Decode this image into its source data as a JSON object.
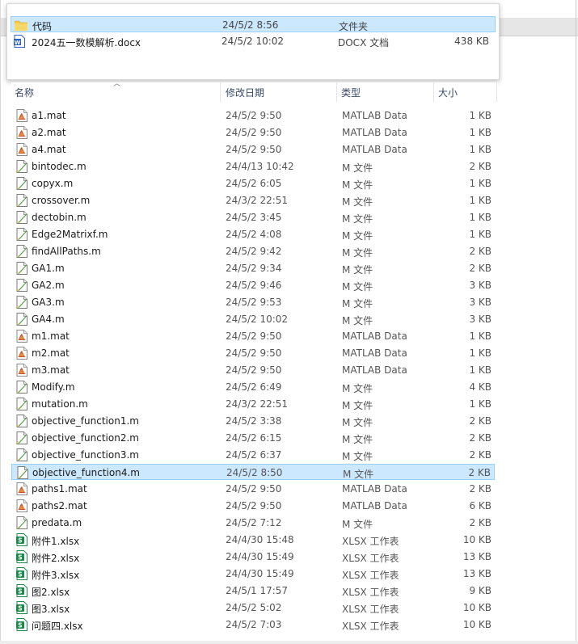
{
  "popup": {
    "rows": [
      {
        "icon": "folder-icon",
        "name": "代码",
        "date": "24/5/2 8:56",
        "type": "文件夹",
        "size": "",
        "selected": true
      },
      {
        "icon": "docx-icon",
        "name": "2024五一数模解析.docx",
        "date": "24/5/2 10:02",
        "type": "DOCX 文档",
        "size": "438 KB",
        "selected": false
      }
    ]
  },
  "header": {
    "name": "名称",
    "date": "修改日期",
    "type": "类型",
    "size": "大小"
  },
  "files": [
    {
      "icon": "mat-icon",
      "name": "a1.mat",
      "date": "24/5/2 9:50",
      "type": "MATLAB Data",
      "size": "1 KB"
    },
    {
      "icon": "mat-icon",
      "name": "a2.mat",
      "date": "24/5/2 9:50",
      "type": "MATLAB Data",
      "size": "1 KB"
    },
    {
      "icon": "mat-icon",
      "name": "a4.mat",
      "date": "24/5/2 9:50",
      "type": "MATLAB Data",
      "size": "1 KB"
    },
    {
      "icon": "m-file-icon",
      "name": "bintodec.m",
      "date": "24/4/13 10:42",
      "type": "M 文件",
      "size": "2 KB"
    },
    {
      "icon": "m-file-icon",
      "name": "copyx.m",
      "date": "24/5/2 6:05",
      "type": "M 文件",
      "size": "1 KB"
    },
    {
      "icon": "m-file-icon",
      "name": "crossover.m",
      "date": "24/3/2 22:51",
      "type": "M 文件",
      "size": "1 KB"
    },
    {
      "icon": "m-file-icon",
      "name": "dectobin.m",
      "date": "24/5/2 3:45",
      "type": "M 文件",
      "size": "1 KB"
    },
    {
      "icon": "m-file-icon",
      "name": "Edge2Matrixf.m",
      "date": "24/5/2 4:08",
      "type": "M 文件",
      "size": "1 KB"
    },
    {
      "icon": "m-file-icon",
      "name": "findAllPaths.m",
      "date": "24/5/2 9:42",
      "type": "M 文件",
      "size": "2 KB"
    },
    {
      "icon": "m-file-icon",
      "name": "GA1.m",
      "date": "24/5/2 9:34",
      "type": "M 文件",
      "size": "2 KB"
    },
    {
      "icon": "m-file-icon",
      "name": "GA2.m",
      "date": "24/5/2 9:46",
      "type": "M 文件",
      "size": "3 KB"
    },
    {
      "icon": "m-file-icon",
      "name": "GA3.m",
      "date": "24/5/2 9:53",
      "type": "M 文件",
      "size": "3 KB"
    },
    {
      "icon": "m-file-icon",
      "name": "GA4.m",
      "date": "24/5/2 10:02",
      "type": "M 文件",
      "size": "3 KB"
    },
    {
      "icon": "mat-icon",
      "name": "m1.mat",
      "date": "24/5/2 9:50",
      "type": "MATLAB Data",
      "size": "1 KB"
    },
    {
      "icon": "mat-icon",
      "name": "m2.mat",
      "date": "24/5/2 9:50",
      "type": "MATLAB Data",
      "size": "1 KB"
    },
    {
      "icon": "mat-icon",
      "name": "m3.mat",
      "date": "24/5/2 9:50",
      "type": "MATLAB Data",
      "size": "1 KB"
    },
    {
      "icon": "m-file-icon",
      "name": "Modify.m",
      "date": "24/5/2 6:49",
      "type": "M 文件",
      "size": "4 KB"
    },
    {
      "icon": "m-file-icon",
      "name": "mutation.m",
      "date": "24/3/2 22:51",
      "type": "M 文件",
      "size": "1 KB"
    },
    {
      "icon": "m-file-icon",
      "name": "objective_function1.m",
      "date": "24/5/2 3:38",
      "type": "M 文件",
      "size": "2 KB"
    },
    {
      "icon": "m-file-icon",
      "name": "objective_function2.m",
      "date": "24/5/2 6:15",
      "type": "M 文件",
      "size": "2 KB"
    },
    {
      "icon": "m-file-icon",
      "name": "objective_function3.m",
      "date": "24/5/2 6:37",
      "type": "M 文件",
      "size": "2 KB"
    },
    {
      "icon": "m-file-icon",
      "name": "objective_function4.m",
      "date": "24/5/2 8:50",
      "type": "M 文件",
      "size": "2 KB",
      "selected": true
    },
    {
      "icon": "mat-icon",
      "name": "paths1.mat",
      "date": "24/5/2 9:50",
      "type": "MATLAB Data",
      "size": "2 KB"
    },
    {
      "icon": "mat-icon",
      "name": "paths2.mat",
      "date": "24/5/2 9:50",
      "type": "MATLAB Data",
      "size": "6 KB"
    },
    {
      "icon": "m-file-icon",
      "name": "predata.m",
      "date": "24/5/2 7:12",
      "type": "M 文件",
      "size": "2 KB"
    },
    {
      "icon": "xlsx-icon",
      "name": "附件1.xlsx",
      "date": "24/4/30 15:48",
      "type": "XLSX 工作表",
      "size": "10 KB"
    },
    {
      "icon": "xlsx-icon",
      "name": "附件2.xlsx",
      "date": "24/4/30 15:49",
      "type": "XLSX 工作表",
      "size": "13 KB"
    },
    {
      "icon": "xlsx-icon",
      "name": "附件3.xlsx",
      "date": "24/4/30 15:49",
      "type": "XLSX 工作表",
      "size": "13 KB"
    },
    {
      "icon": "xlsx-icon",
      "name": "图2.xlsx",
      "date": "24/5/1 17:57",
      "type": "XLSX 工作表",
      "size": "9 KB"
    },
    {
      "icon": "xlsx-icon",
      "name": "图3.xlsx",
      "date": "24/5/2 5:02",
      "type": "XLSX 工作表",
      "size": "10 KB"
    },
    {
      "icon": "xlsx-icon",
      "name": "问题四.xlsx",
      "date": "24/5/2 7:03",
      "type": "XLSX 工作表",
      "size": "10 KB"
    }
  ],
  "colors": {
    "selection_bg": "#cce8ff",
    "selection_border": "#99d1ff",
    "header_text": "#3b4b6b",
    "xlsx_green": "#1d8a4b",
    "docx_blue": "#2b61c9",
    "folder_yellow": "#f3c846"
  }
}
